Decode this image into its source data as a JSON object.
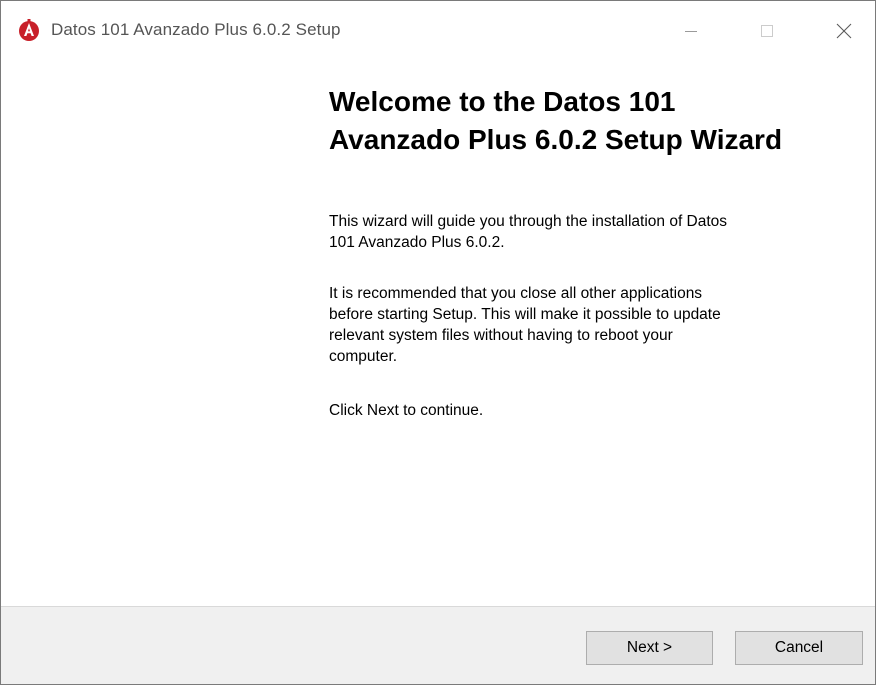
{
  "window": {
    "title": "Datos 101 Avanzado Plus 6.0.2 Setup",
    "app_icon": "app-shield-icon",
    "controls": {
      "minimize": "minimize-icon",
      "maximize": "maximize-icon",
      "close": "close-icon"
    }
  },
  "welcome": {
    "heading_line1": "Welcome to the Datos 101",
    "heading_line2": "Avanzado Plus 6.0.2 Setup Wizard",
    "intro_line1": "This wizard will guide you through the installation of Datos",
    "intro_line2": "101 Avanzado Plus 6.0.2.",
    "advice_line1": "It is recommended that you close all other applications",
    "advice_line2": "before starting Setup. This will make it possible to update",
    "advice_line3": "relevant system files without having to reboot your",
    "advice_line4": "computer.",
    "continue_text": "Click Next to continue."
  },
  "footer": {
    "next_label": "Next >",
    "cancel_label": "Cancel"
  },
  "colors": {
    "icon_red": "#c8202a",
    "footer_bg": "#f0f0f0",
    "button_bg": "#e1e1e1",
    "button_border": "#adadad"
  }
}
